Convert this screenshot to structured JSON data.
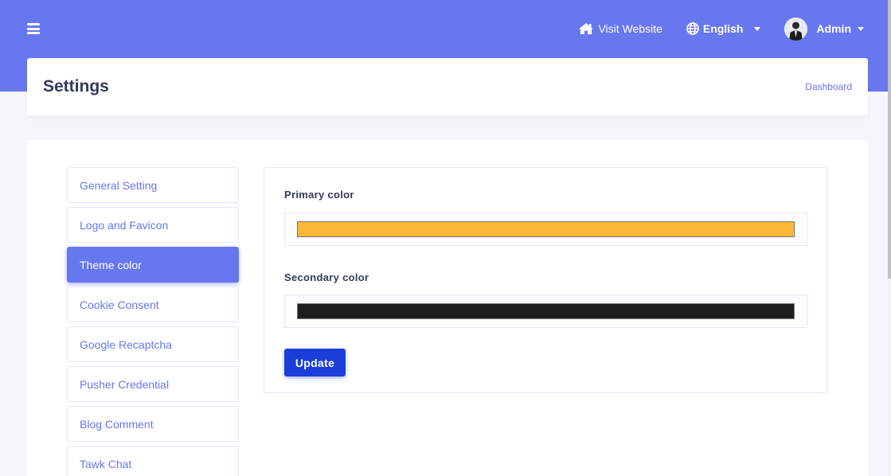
{
  "navbar": {
    "visit_website": "Visit Website",
    "language": "English",
    "user": "Admin"
  },
  "header": {
    "title": "Settings",
    "breadcrumb": "Dashboard"
  },
  "sidebar": {
    "items": [
      {
        "label": "General Setting",
        "active": false
      },
      {
        "label": "Logo and Favicon",
        "active": false
      },
      {
        "label": "Theme color",
        "active": true
      },
      {
        "label": "Cookie Consent",
        "active": false
      },
      {
        "label": "Google Recaptcha",
        "active": false
      },
      {
        "label": "Pusher Credential",
        "active": false
      },
      {
        "label": "Blog Comment",
        "active": false
      },
      {
        "label": "Tawk Chat",
        "active": false
      }
    ]
  },
  "form": {
    "primary_label": "Primary color",
    "primary_value": "#fdb83a",
    "secondary_label": "Secondary color",
    "secondary_value": "#1e1e1e",
    "update_label": "Update"
  },
  "colors": {
    "accent": "#6777ef",
    "button": "#1a3fd8"
  },
  "icons": [
    "menu-icon",
    "home-icon",
    "globe-icon",
    "avatar"
  ]
}
